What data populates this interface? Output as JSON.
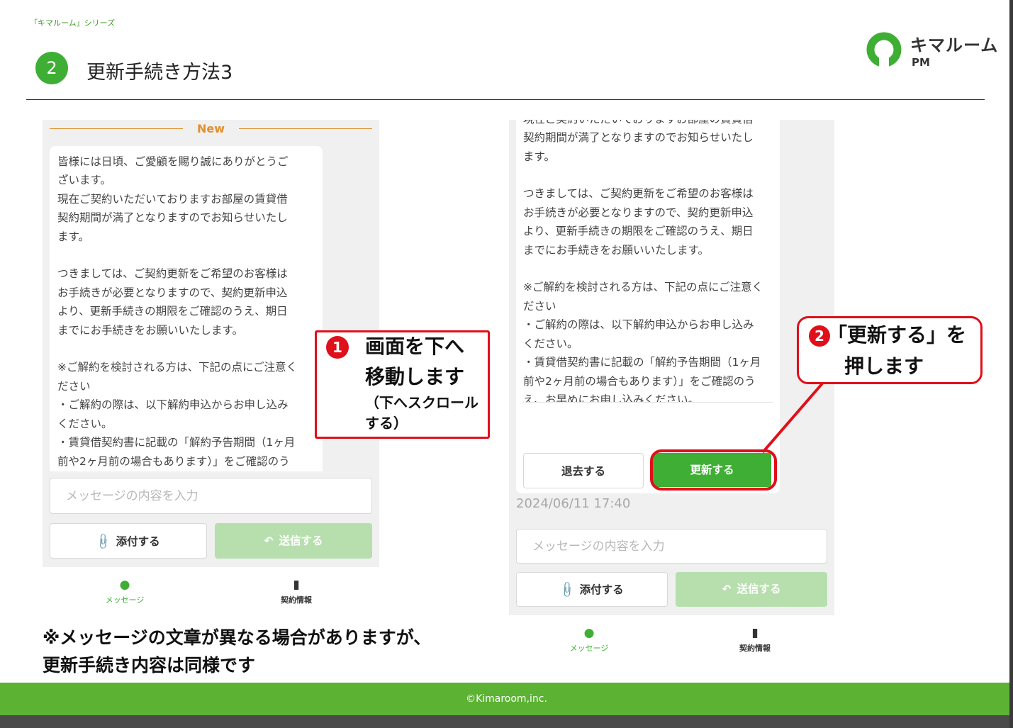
{
  "header": {
    "series": "「キマルーム」シリーズ",
    "step_number": "2",
    "title": "更新手続き方法3",
    "logo_text": "キマルーム",
    "logo_sub": "PM",
    "brand_color": "#3fae34"
  },
  "left_panel": {
    "new_label": "New",
    "message": "皆様には日頃、ご愛顧を賜り誠にありがとうご\nざいます。\n現在ご契約いただいておりますお部屋の賃貸借\n契約期間が満了となりますのでお知らせいたし\nます。\n\nつきましては、ご契約更新をご希望のお客様は\nお手続きが必要となりますので、契約更新申込\nより、更新手続きの期限をご確認のうえ、期日\nまでにお手続きをお願いいたします。\n\n※ご解約を検討される方は、下記の点にご注意く\nださい\n・ご解約の際は、以下解約申込からお申し込み\nください。\n・賃貸借契約書に記載の「解約予告期間（1ヶ月\n前や2ヶ月前の場合もあります）」をご確認のう",
    "input_placeholder": "メッセージの内容を入力",
    "attach_label": "添付する",
    "send_label": "送信する",
    "nav_message": "メッセージ",
    "nav_contract": "契約情報"
  },
  "right_panel": {
    "message": "皆様には日頃、ご愛顧を賜り誠にありがとうご\nざいます。\n現在ご契約いただいておりますお部屋の賃貸借\n契約期間が満了となりますのでお知らせいたし\nます。\n\nつきましては、ご契約更新をご希望のお客様は\nお手続きが必要となりますので、契約更新申込\nより、更新手続きの期限をご確認のうえ、期日\nまでにお手続きをお願いいたします。\n\n※ご解約を検討される方は、下記の点にご注意く\nださい\n・ご解約の際は、以下解約申込からお申し込み\nください。\n・賃貸借契約書に記載の「解約予告期間（1ヶ月\n前や2ヶ月前の場合もあります）」をご確認のう\nえ、お早めにお申し込みください。",
    "leave_label": "退去する",
    "renew_label": "更新する",
    "timestamp": "2024/06/11 17:40",
    "input_placeholder": "メッセージの内容を入力",
    "attach_label": "添付する",
    "send_label": "送信する",
    "nav_message": "メッセージ",
    "nav_contract": "契約情報"
  },
  "annotation_1": {
    "badge": "1",
    "line1": "画面を下へ",
    "line2": "移動します",
    "line3": "（下へスクロール",
    "line4": "する）"
  },
  "annotation_2": {
    "badge": "2",
    "line1": "「更新する」を",
    "line2": "押します"
  },
  "note": {
    "line1": "※メッセージの文章が異なる場合がありますが、",
    "line2": "更新手続き内容は同様です"
  },
  "footer": {
    "copyright": "©Kimaroom,inc."
  },
  "colors": {
    "accent_green": "#3fae34",
    "annotation_red": "#e0101a",
    "new_orange": "#e0902e",
    "footer_green": "#5bb233"
  }
}
